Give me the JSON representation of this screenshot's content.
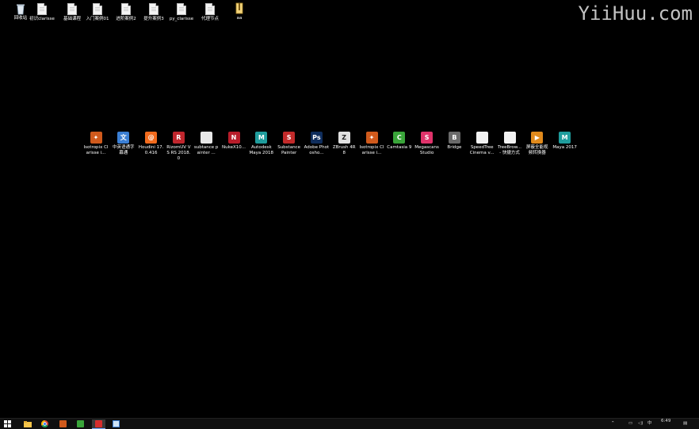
{
  "watermark": "YiiHuu.com",
  "desktop_top_icons": [
    {
      "label": "回收站",
      "icon": "recycle-bin-icon"
    },
    {
      "label": "初识clarisse",
      "icon": "document-icon"
    },
    {
      "label": "基础课程",
      "icon": "document-icon"
    },
    {
      "label": "入门案例01",
      "icon": "document-icon"
    },
    {
      "label": "进阶案例2",
      "icon": "document-icon"
    },
    {
      "label": "提升案例3",
      "icon": "document-icon"
    },
    {
      "label": "py_clarisse",
      "icon": "document-icon"
    },
    {
      "label": "代理节点",
      "icon": "document-icon"
    },
    {
      "label": "aa",
      "icon": "archive-icon"
    }
  ],
  "desktop_apps": [
    {
      "label": "Isotropix Clarisse i...",
      "icon": "clarisse-icon",
      "glyph": "✦",
      "color": "#d05a1c"
    },
    {
      "label": "中英语通字幕通",
      "icon": "subtitle-app-icon",
      "glyph": "文",
      "color": "#3b7fd4"
    },
    {
      "label": "Houdini 17.0.416",
      "icon": "houdini-icon",
      "glyph": "@",
      "color": "#f26b1d"
    },
    {
      "label": "RizomUV VS RS 2018.0",
      "icon": "rizomuv-icon",
      "glyph": "R",
      "color": "#c0262d"
    },
    {
      "label": "subtance painter ...",
      "icon": "shortcut-document-icon",
      "glyph": "",
      "color": "#e8e8e8"
    },
    {
      "label": "NukeX10...",
      "icon": "nuke-icon",
      "glyph": "N",
      "color": "#b81c2a"
    },
    {
      "label": "Autodesk Maya 2018",
      "icon": "maya-icon",
      "glyph": "M",
      "color": "#1f9c9c"
    },
    {
      "label": "Substance Painter",
      "icon": "substance-painter-icon",
      "glyph": "S",
      "color": "#c22a2a"
    },
    {
      "label": "Adobe Photosho...",
      "icon": "photoshop-icon",
      "glyph": "Ps",
      "color": "#0f2d5c"
    },
    {
      "label": "ZBrush 4R8",
      "icon": "zbrush-icon",
      "glyph": "Z",
      "color": "#e0e0e0"
    },
    {
      "label": "Isotropix Clarisse i...",
      "icon": "clarisse-icon",
      "glyph": "✦",
      "color": "#d05a1c"
    },
    {
      "label": "Camtasia 9",
      "icon": "camtasia-icon",
      "glyph": "C",
      "color": "#3aa53a"
    },
    {
      "label": "Megascans Studio",
      "icon": "megascans-icon",
      "glyph": "S",
      "color": "#e0336b"
    },
    {
      "label": "Bridge",
      "icon": "bridge-icon",
      "glyph": "B",
      "color": "#6a6a6a"
    },
    {
      "label": "SpeedTree Cinema v...",
      "icon": "speedtree-icon",
      "glyph": "",
      "color": "#f2f2f2"
    },
    {
      "label": "TreeBrow... - 快捷方式",
      "icon": "treebrowser-icon",
      "glyph": "",
      "color": "#f2f2f2"
    },
    {
      "label": "屏蔽全能视频转换器",
      "icon": "video-converter-icon",
      "glyph": "▶",
      "color": "#e08a1c"
    },
    {
      "label": "Maya 2017",
      "icon": "maya-icon",
      "glyph": "M",
      "color": "#1f9c9c"
    }
  ],
  "taskbar": {
    "items": [
      {
        "name": "start-button",
        "icon": "windows-start-icon"
      },
      {
        "name": "file-explorer-button",
        "icon": "folder-icon"
      },
      {
        "name": "chrome-button",
        "icon": "chrome-icon"
      },
      {
        "name": "clarisse-button",
        "icon": "clarisse-icon"
      },
      {
        "name": "camtasia-button",
        "icon": "camtasia-icon"
      },
      {
        "name": "recorder-button",
        "icon": "recorder-icon"
      },
      {
        "name": "app-button",
        "icon": "app-icon"
      }
    ],
    "time": "6:49",
    "ime": "中"
  }
}
